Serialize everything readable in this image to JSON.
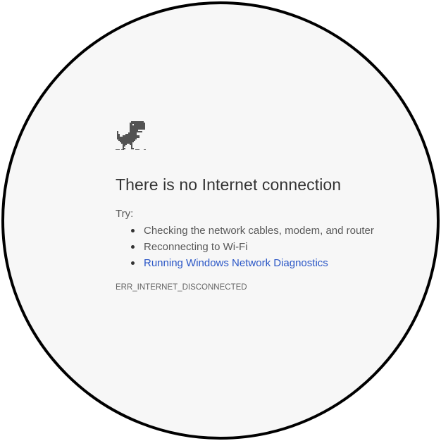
{
  "page": {
    "title": "There is no Internet connection",
    "try_label": "Try:",
    "suggestions": [
      {
        "text": "Checking the network cables, modem, and router",
        "is_link": false
      },
      {
        "text": "Reconnecting to Wi-Fi",
        "is_link": false
      },
      {
        "text": "Running Windows Network Diagnostics",
        "is_link": true
      }
    ],
    "error_code": "ERR_INTERNET_DISCONNECTED"
  },
  "icons": {
    "dino": "offline-dinosaur-icon"
  },
  "colors": {
    "background": "#f7f7f7",
    "text": "#333333",
    "link": "#2a56c6",
    "error_code": "#646464",
    "frame": "#000000"
  }
}
